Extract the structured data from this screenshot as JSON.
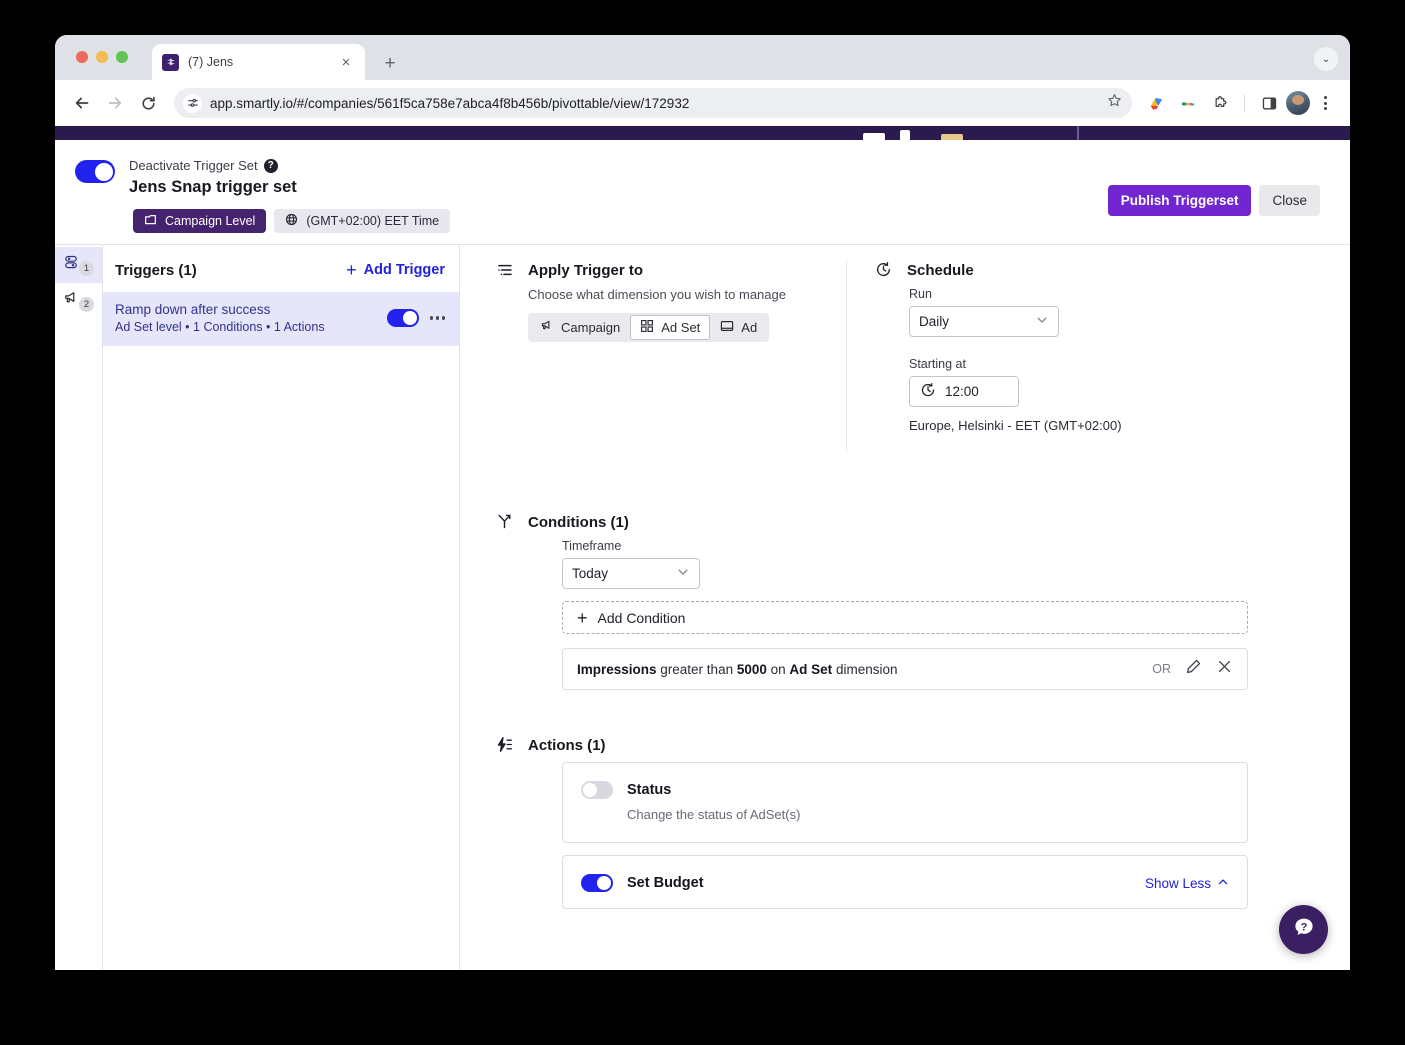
{
  "browser": {
    "tab": {
      "title": "(7) Jens",
      "favicon": "smartly-logo-icon",
      "close": "×"
    },
    "newtab_label": "+",
    "tabstrip_menu": "⌄",
    "url": "app.smartly.io/#/companies/561f5ca758e7abca4f8b456b/pivottable/view/172932",
    "back": "←",
    "forward": "→",
    "reload": "↻",
    "star": "☆"
  },
  "header": {
    "toggle_label": "Deactivate Trigger Set",
    "help_glyph": "?",
    "title": "Jens Snap trigger set",
    "toggle_state": "on",
    "badges": [
      {
        "label": "Campaign Level",
        "icon": "folder-icon",
        "style": "solid"
      },
      {
        "label": "(GMT+02:00) EET Time",
        "icon": "globe-icon",
        "style": "ghost"
      }
    ],
    "publish_label": "Publish Triggerset",
    "close_label": "Close"
  },
  "rail": [
    {
      "icon": "trigger-set-icon",
      "badge": "1",
      "active": true
    },
    {
      "icon": "megaphone-icon",
      "badge": "2",
      "active": false
    }
  ],
  "triggers": {
    "title": "Triggers (1)",
    "add_label": "Add Trigger",
    "add_glyph": "+",
    "items": [
      {
        "name": "Ramp down after success",
        "meta": "Ad Set level • 1 Conditions • 1 Actions",
        "toggle_state": "on"
      }
    ]
  },
  "apply": {
    "title": "Apply Trigger to",
    "hint": "Choose what dimension you wish to manage",
    "options": [
      {
        "label": "Campaign",
        "icon": "megaphone-icon",
        "selected": false
      },
      {
        "label": "Ad Set",
        "icon": "grid-icon",
        "selected": true
      },
      {
        "label": "Ad",
        "icon": "ad-frame-icon",
        "selected": false
      }
    ]
  },
  "schedule": {
    "title": "Schedule",
    "icon": "clock-icon",
    "run_label": "Run",
    "run_value": "Daily",
    "starting_label": "Starting at",
    "starting_value": "12:00",
    "timezone": "Europe, Helsinki - EET (GMT+02:00)"
  },
  "conditions": {
    "title": "Conditions (1)",
    "icon": "branch-icon",
    "timeframe_label": "Timeframe",
    "timeframe_value": "Today",
    "add_label": "Add Condition",
    "add_glyph": "+",
    "rows": [
      {
        "metric": "Impressions",
        "operator": " greater than ",
        "value": "5000",
        "on": " on ",
        "dimension": "Ad Set",
        "suffix": " dimension",
        "logic": "OR",
        "edit_icon": "pencil-icon",
        "delete_icon": "close-icon"
      }
    ]
  },
  "actions": {
    "title": "Actions (1)",
    "icon": "lightning-icon",
    "cards": [
      {
        "name": "Status",
        "desc": "Change the status of AdSet(s)",
        "toggle_state": "off",
        "link": ""
      },
      {
        "name": "Set Budget",
        "desc": "",
        "toggle_state": "on",
        "link": "Show Less"
      }
    ]
  },
  "help": {
    "icon": "question-chat-icon",
    "glyph": "?"
  },
  "colors": {
    "brand_purple": "#7126d0",
    "dark_purple": "#2b1a4d",
    "badge_purple": "#46236e",
    "toggle_blue": "#2222ee",
    "link_blue": "#2222dd",
    "selected_row": "#e6e6fb"
  }
}
